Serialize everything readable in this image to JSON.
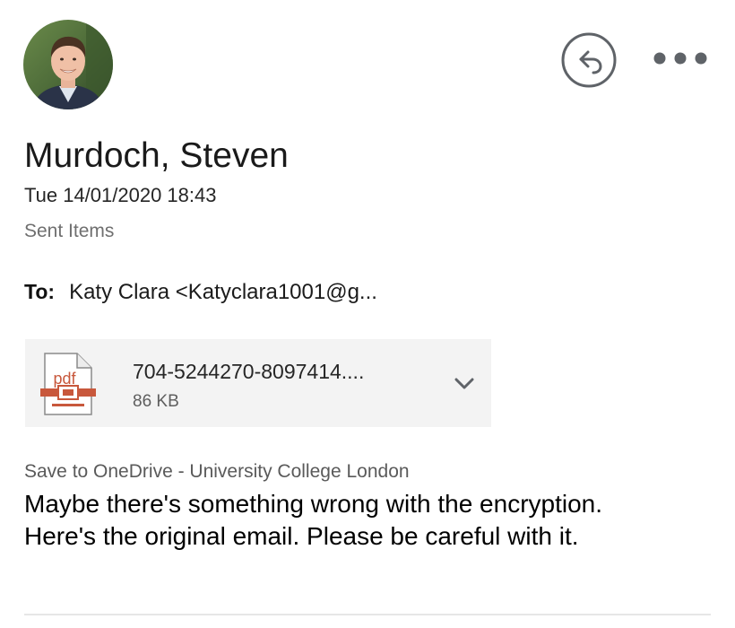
{
  "sender": {
    "avatar_icon": "person-avatar",
    "name": "Murdoch, Steven",
    "date": "Tue 14/01/2020 18:43",
    "folder": "Sent Items"
  },
  "actions": {
    "reply_icon": "reply-icon",
    "more_icon": "more-options-icon"
  },
  "recipients": {
    "to_label": "To:",
    "to_value": "Katy Clara <Katyclara1001@g..."
  },
  "attachment": {
    "icon": "pdf-file-icon",
    "icon_text": "pdf",
    "filename": "704-5244270-8097414....",
    "size": "86 KB",
    "chevron_icon": "chevron-down-icon"
  },
  "save_link": "Save to OneDrive - University College London",
  "message": {
    "line1": "Maybe there's something wrong with the encryption.",
    "line2": "Here's the original email. Please be careful with it."
  },
  "colors": {
    "attachment_bg": "#f3f3f3",
    "pdf_accent": "#c8583c",
    "icon_gray": "#5f6368",
    "muted_text": "#6f6f6f"
  }
}
